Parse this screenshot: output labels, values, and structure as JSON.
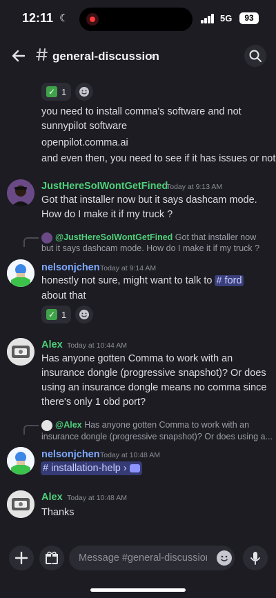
{
  "status": {
    "time": "12:11",
    "network": "5G",
    "battery": "93"
  },
  "header": {
    "channel": "general-discussion"
  },
  "top_messages": {
    "reaction_count": "1",
    "lines": [
      "you need to install comma's software and not",
      "sunnypilot software",
      "openpilot.comma.ai",
      "and even then, you need to see if it has issues or not"
    ]
  },
  "msg1": {
    "username": "JustHereSoIWontGetFined",
    "timestamp": "Today at 9:13 AM",
    "lines": [
      "Got that installer now but it says dashcam mode.",
      "How do I make it if my truck ?"
    ]
  },
  "msg2": {
    "reply_name": "@JustHereSoIWontGetFined",
    "reply_line1": "Got that installer now",
    "reply_line2": "but it says dashcam mode. How do I make it if my truck ?",
    "username": "nelsonjchen",
    "timestamp": "Today at 9:14 AM",
    "line1_text": "honestly not sure, might want to talk to ",
    "mention": "# ford",
    "line2": "about that",
    "reaction_count": "1"
  },
  "msg3": {
    "username": "Alex",
    "timestamp": "Today at 10:44 AM",
    "lines": [
      "Has anyone gotten Comma to work with an",
      "insurance dongle (progressive snapshot)? Or does",
      "using an insurance dongle means no comma since",
      "there's only 1 obd port?"
    ]
  },
  "msg4": {
    "reply_name": "@Alex",
    "reply_line1": "Has anyone gotten Comma to work with an",
    "reply_line2": "insurance dongle (progressive snapshot)? Or does using a...",
    "username": "nelsonjchen",
    "timestamp": "Today at 10:48 AM",
    "channel_link": "# installation-help ›"
  },
  "msg5": {
    "username": "Alex",
    "timestamp": "Today at 10:48 AM",
    "text": "Thanks"
  },
  "composer": {
    "placeholder": "Message #general-discussion"
  },
  "colors": {
    "green_name": "#4fd07a",
    "blue_name": "#7ea8ff",
    "mention_bg": "#3a3f7c"
  }
}
